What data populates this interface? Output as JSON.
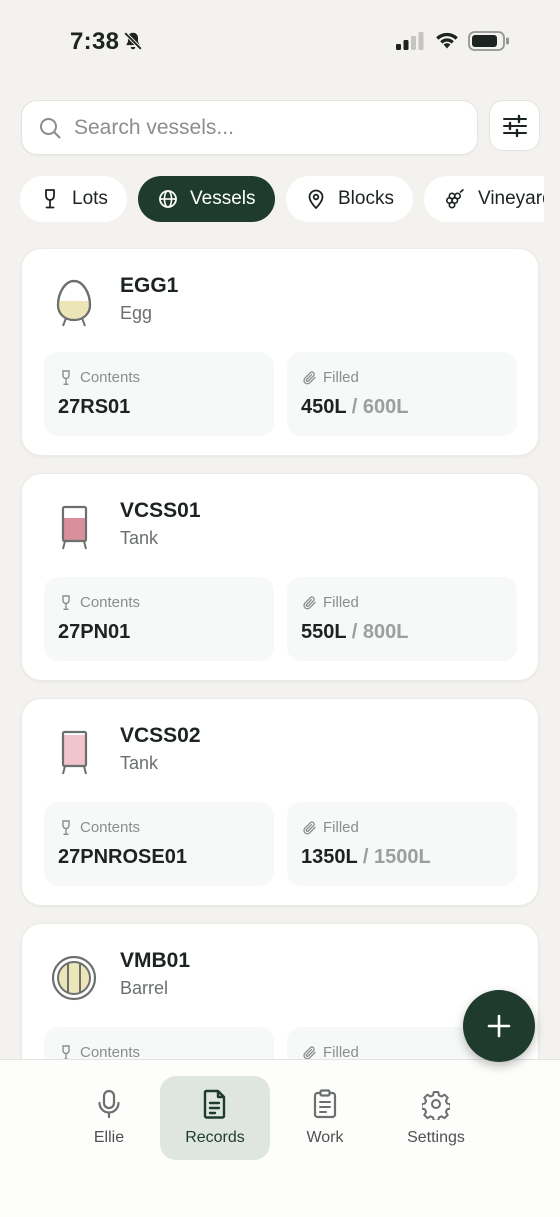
{
  "status_bar": {
    "time": "7:38"
  },
  "search": {
    "placeholder": "Search vessels..."
  },
  "chips": [
    {
      "label": "Lots",
      "icon": "wine-glass-icon",
      "active": false
    },
    {
      "label": "Vessels",
      "icon": "globe-icon",
      "active": true
    },
    {
      "label": "Blocks",
      "icon": "map-pin-icon",
      "active": false
    },
    {
      "label": "Vineyards",
      "icon": "grapes-icon",
      "active": false
    }
  ],
  "stat_labels": {
    "contents": "Contents",
    "filled": "Filled"
  },
  "vessels": [
    {
      "name": "EGG1",
      "type": "Egg",
      "icon": "egg-vessel-icon",
      "contents": "27RS01",
      "filled": "450L",
      "capacity": " / 600L",
      "fill_fraction": 0.75,
      "fill_color": "#ece5b8"
    },
    {
      "name": "VCSS01",
      "type": "Tank",
      "icon": "tank-vessel-icon",
      "contents": "27PN01",
      "filled": "550L",
      "capacity": " / 800L",
      "fill_fraction": 0.6875,
      "fill_color": "#d98f9c"
    },
    {
      "name": "VCSS02",
      "type": "Tank",
      "icon": "tank-vessel-icon",
      "contents": "27PNROSE01",
      "filled": "1350L",
      "capacity": " / 1500L",
      "fill_fraction": 0.9,
      "fill_color": "#f1c3cb"
    },
    {
      "name": "VMB01",
      "type": "Barrel",
      "icon": "barrel-vessel-icon",
      "contents": "",
      "filled": "",
      "capacity": "",
      "fill_fraction": null,
      "fill_color": "#ece5b8"
    }
  ],
  "nav": [
    {
      "label": "Ellie",
      "icon": "microphone-icon",
      "active": false
    },
    {
      "label": "Records",
      "icon": "document-icon",
      "active": true
    },
    {
      "label": "Work",
      "icon": "clipboard-icon",
      "active": false
    },
    {
      "label": "Settings",
      "icon": "gear-icon",
      "active": false
    }
  ],
  "colors": {
    "accent": "#1f3b2d",
    "background": "#f3f2ef",
    "active_nav": "#dfe6e1"
  }
}
